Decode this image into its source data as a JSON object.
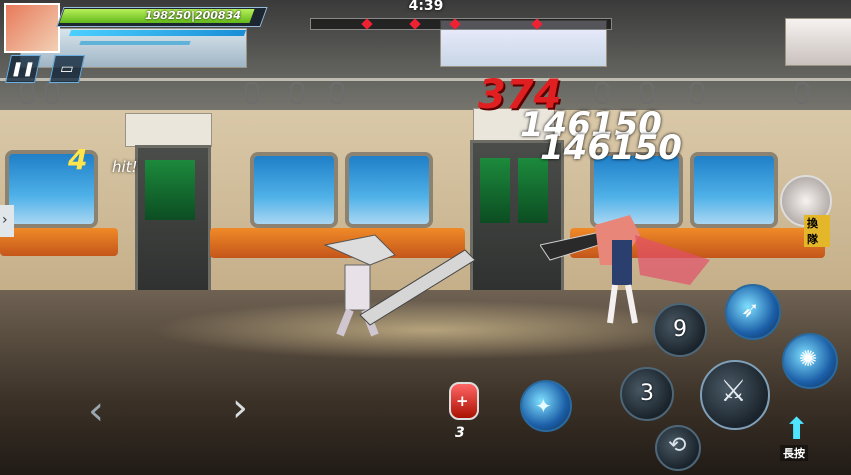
{
  "hud": {
    "hp_current": "198250",
    "hp_max": "200834",
    "timer": "4:39",
    "pause_icon": "pause-icon",
    "screen_icon": "screen-icon"
  },
  "combat": {
    "combo_count": "4",
    "combo_label": "hit!",
    "damage_red": "374",
    "damage_white_1": "146150",
    "damage_white_2": "146150"
  },
  "controls": {
    "potion_count": "3",
    "skill1_cooldown": "9",
    "skill2_cooldown": "3",
    "switch_label": "換隊",
    "evade_label": "長按",
    "left_arrow_icon": "left-arrow-icon",
    "right_arrow_icon": "right-arrow-icon"
  },
  "colors": {
    "hp_fill": "#7ed321",
    "mp_fill": "#3ab8f0",
    "damage_red": "#e02020",
    "skill_glow": "#4fc3ff",
    "seat_orange": "#f08a28"
  }
}
